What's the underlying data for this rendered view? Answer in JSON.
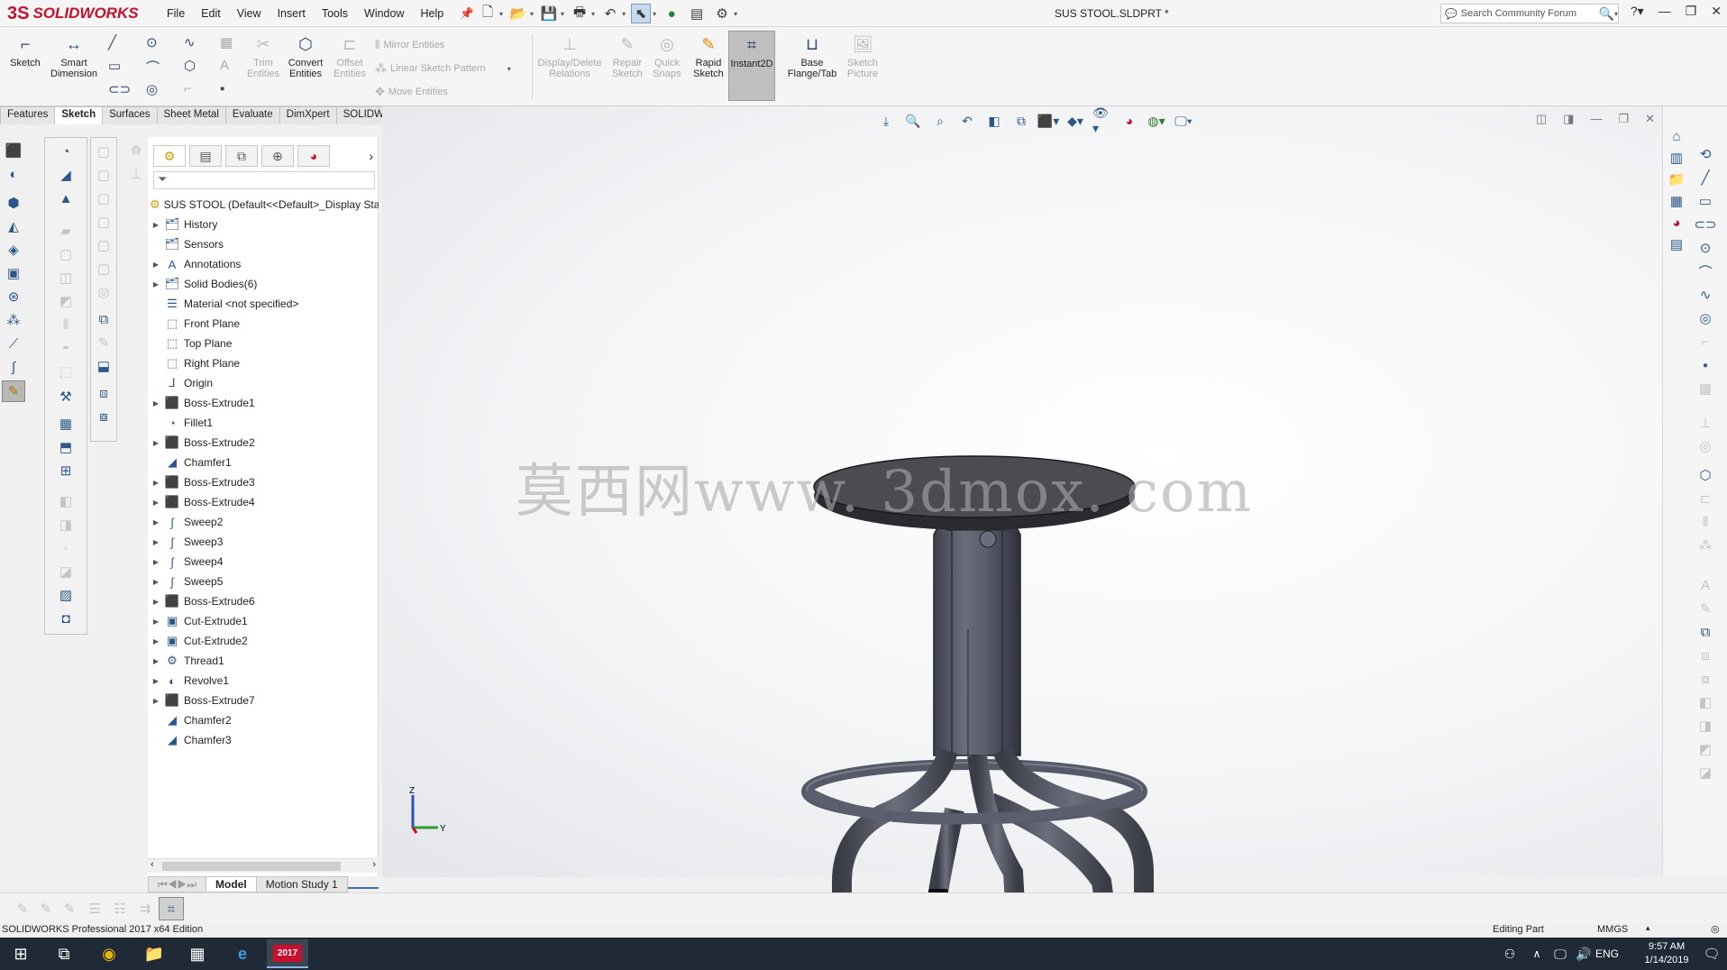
{
  "app": {
    "brand": "SOLIDWORKS",
    "brand_prefix": "3S",
    "document_title": "SUS STOOL.SLDPRT *"
  },
  "menu": [
    "File",
    "Edit",
    "View",
    "Insert",
    "Tools",
    "Window",
    "Help"
  ],
  "search": {
    "placeholder": "Search Community Forum"
  },
  "commands": {
    "sketch": "Sketch",
    "smart_dimension": "Smart Dimension",
    "trim": "Trim Entities",
    "convert": "Convert Entities",
    "offset": "Offset Entities",
    "mirror": "Mirror Entities",
    "linear_pattern": "Linear Sketch Pattern",
    "move": "Move Entities",
    "display_delete": "Display/Delete Relations",
    "repair": "Repair Sketch",
    "quick_snaps": "Quick Snaps",
    "rapid_sketch": "Rapid Sketch",
    "instant2d": "Instant2D",
    "base_flange": "Base Flange/Tab",
    "sketch_picture": "Sketch Picture"
  },
  "cmd_tabs": [
    "Features",
    "Sketch",
    "Surfaces",
    "Sheet Metal",
    "Evaluate",
    "DimXpert",
    "SOLIDWORKS Add-Ins"
  ],
  "active_cmd_tab": "Sketch",
  "tree": {
    "root": "SUS STOOL  (Default<<Default>_Display Sta",
    "items": [
      {
        "label": "History",
        "expand": true,
        "icon": "history-folder-icon"
      },
      {
        "label": "Sensors",
        "expand": false,
        "icon": "sensors-folder-icon"
      },
      {
        "label": "Annotations",
        "expand": true,
        "icon": "annotations-icon"
      },
      {
        "label": "Solid Bodies(6)",
        "expand": true,
        "icon": "solid-bodies-icon"
      },
      {
        "label": "Material <not specified>",
        "expand": false,
        "icon": "material-icon"
      },
      {
        "label": "Front Plane",
        "expand": false,
        "icon": "plane-icon"
      },
      {
        "label": "Top Plane",
        "expand": false,
        "icon": "plane-icon"
      },
      {
        "label": "Right Plane",
        "expand": false,
        "icon": "plane-icon"
      },
      {
        "label": "Origin",
        "expand": false,
        "icon": "origin-icon"
      },
      {
        "label": "Boss-Extrude1",
        "expand": true,
        "icon": "extrude-icon"
      },
      {
        "label": "Fillet1",
        "expand": false,
        "icon": "fillet-icon"
      },
      {
        "label": "Boss-Extrude2",
        "expand": true,
        "icon": "extrude-icon"
      },
      {
        "label": "Chamfer1",
        "expand": false,
        "icon": "chamfer-icon"
      },
      {
        "label": "Boss-Extrude3",
        "expand": true,
        "icon": "extrude-icon"
      },
      {
        "label": "Boss-Extrude4",
        "expand": true,
        "icon": "extrude-icon"
      },
      {
        "label": "Sweep2",
        "expand": true,
        "icon": "sweep-icon"
      },
      {
        "label": "Sweep3",
        "expand": true,
        "icon": "sweep-icon"
      },
      {
        "label": "Sweep4",
        "expand": true,
        "icon": "sweep-icon"
      },
      {
        "label": "Sweep5",
        "expand": true,
        "icon": "sweep-icon"
      },
      {
        "label": "Boss-Extrude6",
        "expand": true,
        "icon": "extrude-icon"
      },
      {
        "label": "Cut-Extrude1",
        "expand": true,
        "icon": "cut-extrude-icon"
      },
      {
        "label": "Cut-Extrude2",
        "expand": true,
        "icon": "cut-extrude-icon"
      },
      {
        "label": "Thread1",
        "expand": true,
        "icon": "thread-icon"
      },
      {
        "label": "Revolve1",
        "expand": true,
        "icon": "revolve-icon"
      },
      {
        "label": "Boss-Extrude7",
        "expand": true,
        "icon": "extrude-icon"
      },
      {
        "label": "Chamfer2",
        "expand": false,
        "icon": "chamfer-icon"
      },
      {
        "label": "Chamfer3",
        "expand": false,
        "icon": "chamfer-icon"
      }
    ]
  },
  "bottom_tabs": [
    "Model",
    "Motion Study 1"
  ],
  "watermark": "莫西网www. 3dmox. com",
  "triad": {
    "z": "Z",
    "y": "Y"
  },
  "status": {
    "edition": "SOLIDWORKS Professional 2017 x64 Edition",
    "mode": "Editing Part",
    "units": "MMGS"
  },
  "taskbar": {
    "lang": "ENG",
    "time": "9:57 AM",
    "date": "1/14/2019",
    "sw_label": "2017"
  },
  "colors": {
    "brand": "#c8102e",
    "accent": "#3a6fb5",
    "stool_body": "#5c5f6e",
    "seat": "#4a4c52"
  }
}
